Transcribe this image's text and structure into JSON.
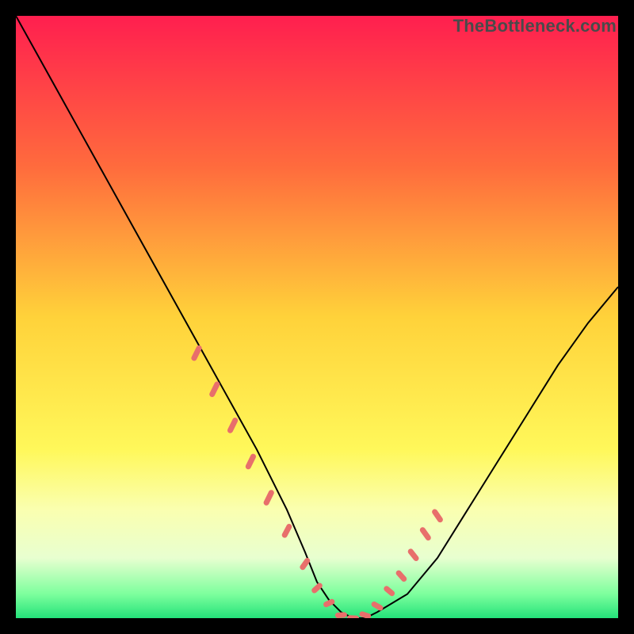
{
  "watermark": "TheBottleneck.com",
  "chart_data": {
    "type": "line",
    "title": "",
    "xlabel": "",
    "ylabel": "",
    "xlim": [
      0,
      100
    ],
    "ylim": [
      0,
      100
    ],
    "grid": false,
    "background_gradient": {
      "stops": [
        {
          "offset": 0.0,
          "color": "#ff1f4f"
        },
        {
          "offset": 0.25,
          "color": "#ff6b3d"
        },
        {
          "offset": 0.5,
          "color": "#ffd23a"
        },
        {
          "offset": 0.72,
          "color": "#fff85a"
        },
        {
          "offset": 0.82,
          "color": "#faffb0"
        },
        {
          "offset": 0.9,
          "color": "#e8ffd0"
        },
        {
          "offset": 0.96,
          "color": "#7dff9d"
        },
        {
          "offset": 1.0,
          "color": "#24e27a"
        }
      ]
    },
    "series": [
      {
        "name": "bottleneck-curve",
        "color": "#000000",
        "x": [
          0,
          5,
          10,
          15,
          20,
          25,
          30,
          35,
          40,
          45,
          48,
          50,
          52,
          54,
          56,
          58,
          60,
          65,
          70,
          75,
          80,
          85,
          90,
          95,
          100
        ],
        "y": [
          100,
          91,
          82,
          73,
          64,
          55,
          46,
          37,
          28,
          18,
          11,
          6,
          3,
          1,
          0,
          0,
          1,
          4,
          10,
          18,
          26,
          34,
          42,
          49,
          55
        ]
      }
    ],
    "highlight_dashes": {
      "color": "#e86f6b",
      "segments": [
        {
          "x": 30,
          "y1": 48,
          "y2": 40,
          "len": 14,
          "angle": -64
        },
        {
          "x": 33,
          "y1": 42,
          "y2": 34,
          "len": 14,
          "angle": -64
        },
        {
          "x": 36,
          "y1": 36,
          "y2": 28,
          "len": 14,
          "angle": -64
        },
        {
          "x": 39,
          "y1": 30,
          "y2": 22,
          "len": 14,
          "angle": -64
        },
        {
          "x": 42,
          "y1": 24,
          "y2": 16,
          "len": 14,
          "angle": -64
        },
        {
          "x": 45,
          "y1": 18,
          "y2": 11,
          "len": 12,
          "angle": -62
        },
        {
          "x": 48,
          "y1": 12,
          "y2": 6,
          "len": 10,
          "angle": -55
        },
        {
          "x": 50,
          "y1": 7,
          "y2": 3,
          "len": 9,
          "angle": -42
        },
        {
          "x": 52,
          "y1": 4,
          "y2": 1,
          "len": 8,
          "angle": -25
        },
        {
          "x": 54,
          "y1": 1,
          "y2": 0,
          "len": 8,
          "angle": -5
        },
        {
          "x": 56,
          "y1": 0,
          "y2": 0,
          "len": 8,
          "angle": 5
        },
        {
          "x": 58,
          "y1": 0,
          "y2": 1,
          "len": 8,
          "angle": 18
        },
        {
          "x": 60,
          "y1": 1,
          "y2": 3,
          "len": 9,
          "angle": 30
        },
        {
          "x": 62,
          "y1": 3,
          "y2": 6,
          "len": 9,
          "angle": 40
        },
        {
          "x": 64,
          "y1": 5,
          "y2": 9,
          "len": 10,
          "angle": 48
        },
        {
          "x": 66,
          "y1": 8,
          "y2": 13,
          "len": 11,
          "angle": 52
        },
        {
          "x": 68,
          "y1": 11,
          "y2": 17,
          "len": 12,
          "angle": 54
        },
        {
          "x": 70,
          "y1": 14,
          "y2": 20,
          "len": 12,
          "angle": 55
        }
      ]
    }
  }
}
